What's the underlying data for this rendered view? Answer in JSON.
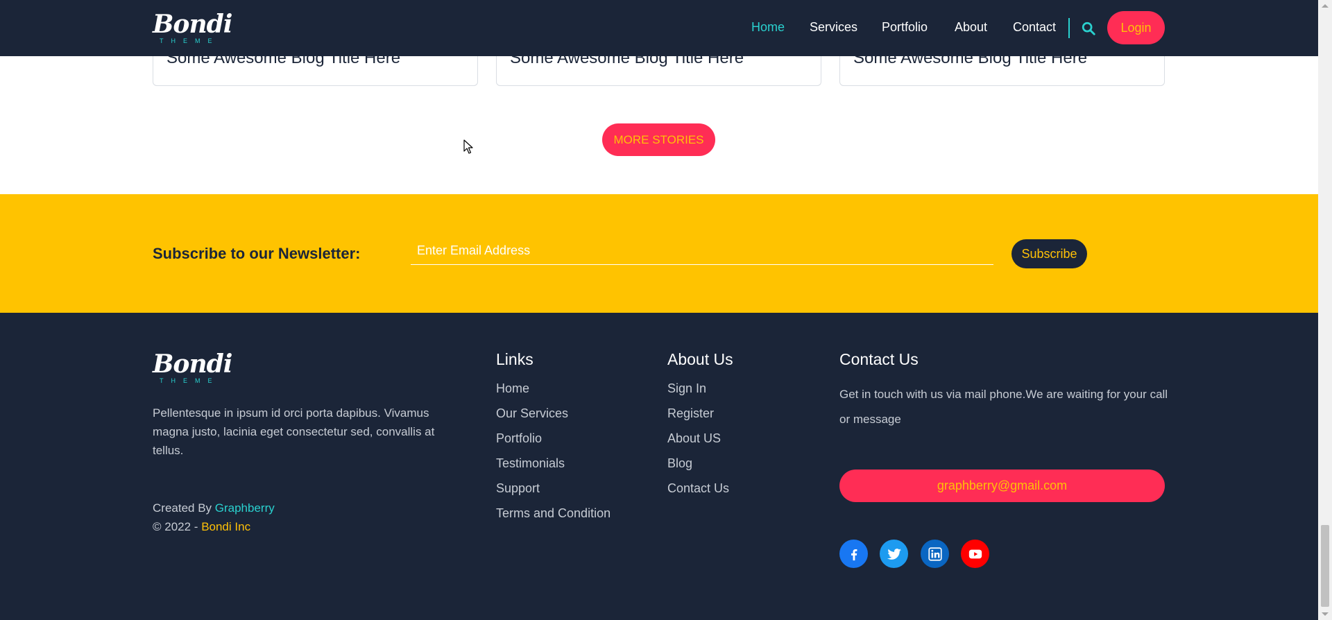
{
  "colors": {
    "navy": "#1b2538",
    "accent_pink": "#ff2d55",
    "accent_yellow": "#ffc107",
    "newsletter_bg": "#ffc300",
    "teal": "#2ad1cf"
  },
  "header": {
    "logo_text": "Bondi",
    "logo_sub": "THEME",
    "nav": [
      {
        "label": "Home",
        "active": true
      },
      {
        "label": "Services"
      },
      {
        "label": "Portfolio"
      },
      {
        "label": "About"
      },
      {
        "label": "Contact"
      }
    ],
    "search_icon": "search-icon",
    "login_label": "Login"
  },
  "blog": {
    "cards": [
      {
        "title": "Some Awesome Blog Title Here"
      },
      {
        "title": "Some Awesome Blog Title Here"
      },
      {
        "title": "Some Awesome Blog Title Here"
      }
    ],
    "more_label": "MORE STORIES"
  },
  "newsletter": {
    "title": "Subscribe to our Newsletter:",
    "placeholder": "Enter Email Address",
    "button_label": "Subscribe"
  },
  "footer": {
    "logo_text": "Bondi",
    "logo_sub": "THEME",
    "description": "Pellentesque in ipsum id orci porta dapibus. Vivamus magna justo, lacinia eget consectetur sed, convallis at tellus.",
    "created_by_prefix": "Created By ",
    "created_by_name": "Graphberry",
    "copyright_prefix": "© 2022 - ",
    "copyright_name": "Bondi Inc",
    "links": {
      "title": "Links",
      "items": [
        "Home",
        "Our Services",
        "Portfolio",
        "Testimonials",
        "Support",
        "Terms and Condition"
      ]
    },
    "about": {
      "title": "About Us",
      "items": [
        "Sign In",
        "Register",
        "About US",
        "Blog",
        "Contact Us"
      ]
    },
    "contact": {
      "title": "Contact Us",
      "text": "Get in touch with us via mail phone.We are waiting for your call or message",
      "email": "graphberry@gmail.com"
    },
    "social": [
      {
        "icon": "facebook-icon",
        "color": "#1877f2"
      },
      {
        "icon": "twitter-icon",
        "color": "#1d9bf0"
      },
      {
        "icon": "linkedin-icon",
        "color": "#0a66c2"
      },
      {
        "icon": "youtube-icon",
        "color": "#ff0000"
      }
    ]
  }
}
